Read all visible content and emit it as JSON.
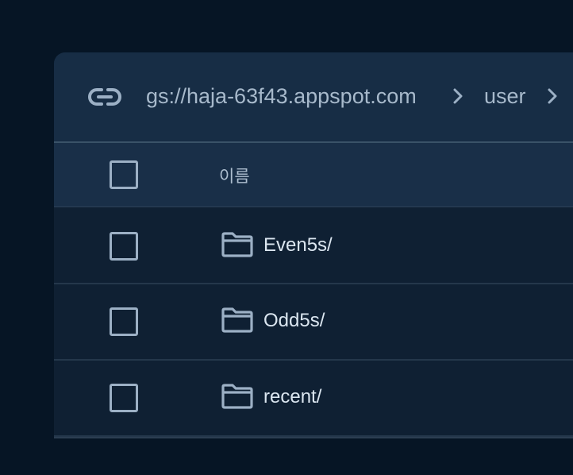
{
  "breadcrumb": {
    "root_icon": "link-icon",
    "items": [
      {
        "label": "gs://haja-63f43.appspot.com"
      },
      {
        "label": "user"
      }
    ],
    "separator_icon": "chevron-right-icon"
  },
  "table": {
    "columns": [
      {
        "label": "이름"
      }
    ],
    "rows": [
      {
        "name": "Even5s/",
        "icon": "folder-icon"
      },
      {
        "name": "Odd5s/",
        "icon": "folder-icon"
      },
      {
        "name": "recent/",
        "icon": "folder-icon"
      }
    ]
  },
  "colors": {
    "page_background": "#061525",
    "panel_background": "#0f2033",
    "path_bar_background": "#172d45",
    "header_background": "#192f48",
    "text_primary": "#dbe6f0",
    "text_secondary": "#a7b9cb",
    "icon": "#9cb0c5"
  }
}
